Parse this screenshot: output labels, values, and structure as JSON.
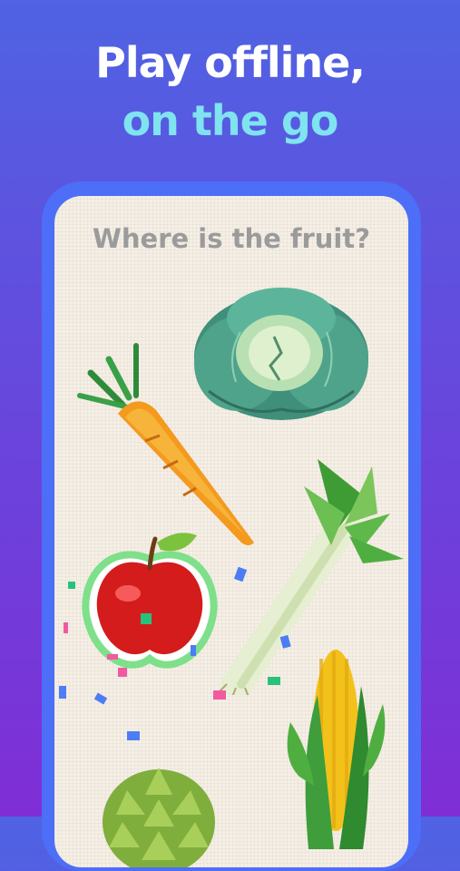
{
  "promo": {
    "line1": "Play offline,",
    "line2": "on the go"
  },
  "game": {
    "question": "Where is the fruit?",
    "items": [
      {
        "name": "cabbage",
        "type": "vegetable"
      },
      {
        "name": "carrot",
        "type": "vegetable"
      },
      {
        "name": "leek",
        "type": "vegetable"
      },
      {
        "name": "apple",
        "type": "fruit",
        "selected": true
      },
      {
        "name": "corn",
        "type": "vegetable"
      },
      {
        "name": "artichoke",
        "type": "vegetable"
      }
    ]
  },
  "colors": {
    "background_top": "#4f63e3",
    "background_bottom": "#7f2ed6",
    "headline_white": "#ffffff",
    "headline_cyan": "#7fe3f0",
    "phone_frame": "#4d6ef7",
    "screen_bg": "#f6efe6",
    "question_text": "#9b9b9b"
  }
}
